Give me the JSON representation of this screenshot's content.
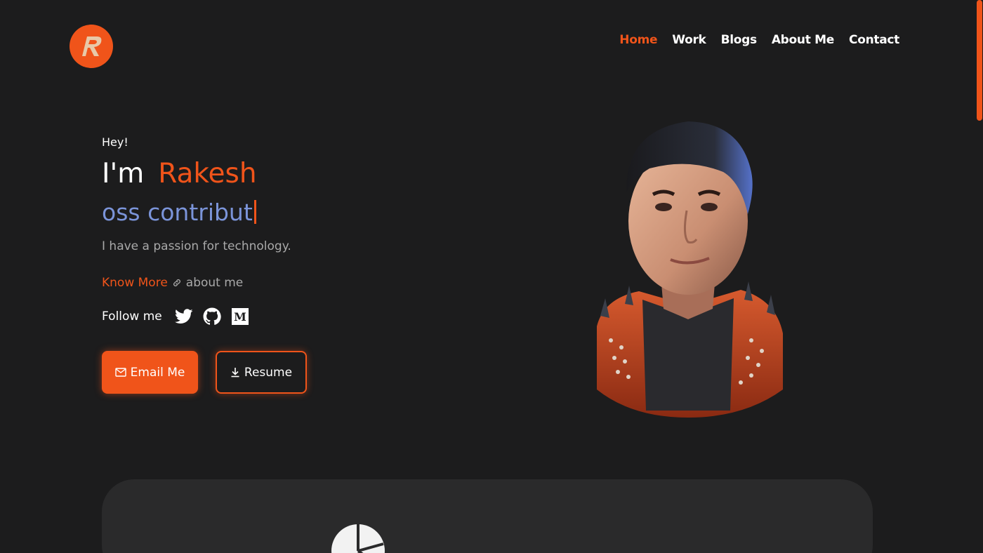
{
  "header": {
    "logo_letter": "R",
    "nav": [
      {
        "label": "Home",
        "active": true
      },
      {
        "label": "Work",
        "active": false
      },
      {
        "label": "Blogs",
        "active": false
      },
      {
        "label": "About Me",
        "active": false
      },
      {
        "label": "Contact",
        "active": false
      }
    ]
  },
  "hero": {
    "greeting": "Hey!",
    "im": "I'm",
    "name": "Rakesh",
    "typing_text": "oss contribut",
    "tagline": "I have a passion for technology.",
    "know_more_link": "Know More",
    "know_more_rest": "about me",
    "follow_label": "Follow me",
    "social": [
      "twitter-icon",
      "github-icon",
      "medium-icon"
    ],
    "email_button": "Email Me",
    "resume_button": "Resume"
  },
  "colors": {
    "background": "#1c1c1d",
    "accent": "#f0541a",
    "typing": "#7b94d9",
    "muted": "#a9a9a9",
    "card": "#2a2a2b"
  }
}
